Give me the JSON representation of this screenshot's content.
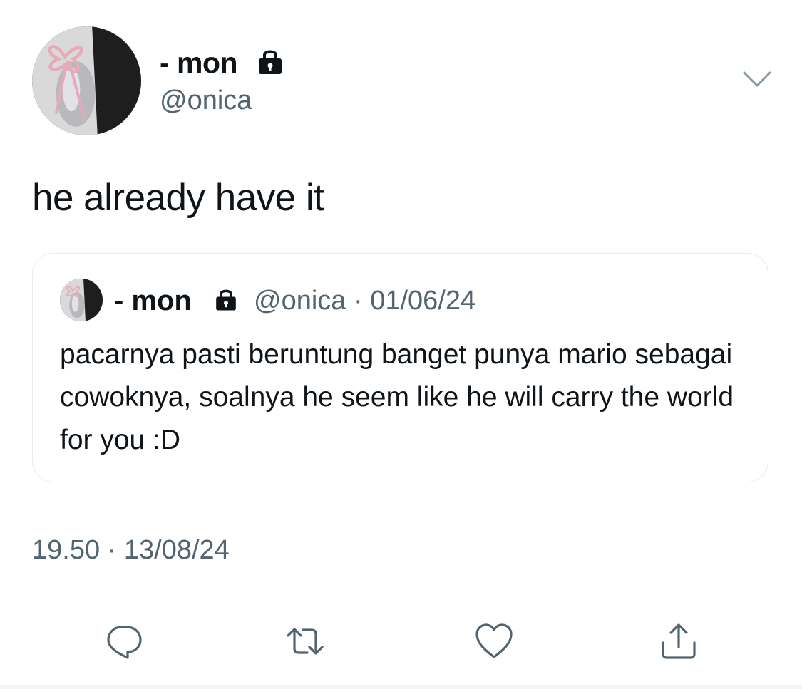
{
  "tweet": {
    "author": {
      "display_name": "- mon",
      "handle": "@onica",
      "locked": true
    },
    "text": "he already have it",
    "timestamp": "19.50 · 13/08/24",
    "menu_icon": "chevron-down-icon"
  },
  "quote": {
    "author": {
      "display_name": "- mon",
      "handle": "@onica",
      "locked": true
    },
    "meta": "@onica · 01/06/24",
    "text": "pacarnya pasti beruntung banget punya mario sebagai cowoknya, soalnya he seem like he will carry the world for you :D"
  },
  "actions": [
    {
      "name": "reply",
      "icon": "comment-icon"
    },
    {
      "name": "retweet",
      "icon": "retweet-icon"
    },
    {
      "name": "like",
      "icon": "heart-icon"
    },
    {
      "name": "share",
      "icon": "share-icon"
    }
  ],
  "colors": {
    "text": "#0f1419",
    "secondary": "#536471",
    "border": "#e6ecf0",
    "icon": "#536471"
  }
}
